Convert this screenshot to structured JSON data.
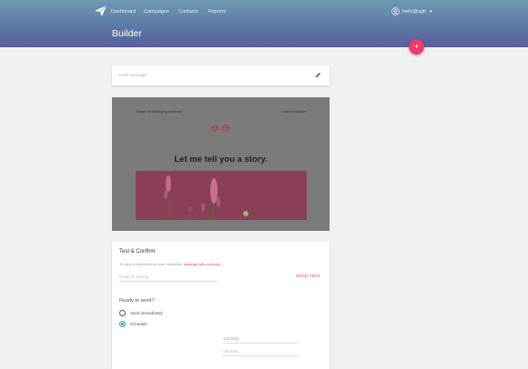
{
  "nav": {
    "items": [
      {
        "label": "Dashboard"
      },
      {
        "label": "Campaigns"
      },
      {
        "label": "Contacts"
      },
      {
        "label": "Reports"
      }
    ],
    "user_name": "hello@sgtl"
  },
  "page": {
    "title": "Builder",
    "fab_label": "+"
  },
  "subject": {
    "text": "Hello message"
  },
  "preview": {
    "top_left": "Email not displaying correctly?",
    "top_right": "View in browser",
    "heading": "Let me tell you a story."
  },
  "confirm": {
    "title": "Test & Confirm",
    "helper_prefix": "To send a test email to more recipients, ",
    "helper_link": "separate with commas",
    "email_placeholder": "Email for testing",
    "send_test": "SEND TEST",
    "ready_label": "Ready to send?",
    "options": [
      {
        "label": "Send immediately",
        "selected": false
      },
      {
        "label": "Schedule",
        "selected": true
      }
    ],
    "date_value": "1/1/2015",
    "time_placeholder": "Set time"
  },
  "colors": {
    "accent": "#f0396f",
    "radio_selected": "#26a69a"
  }
}
